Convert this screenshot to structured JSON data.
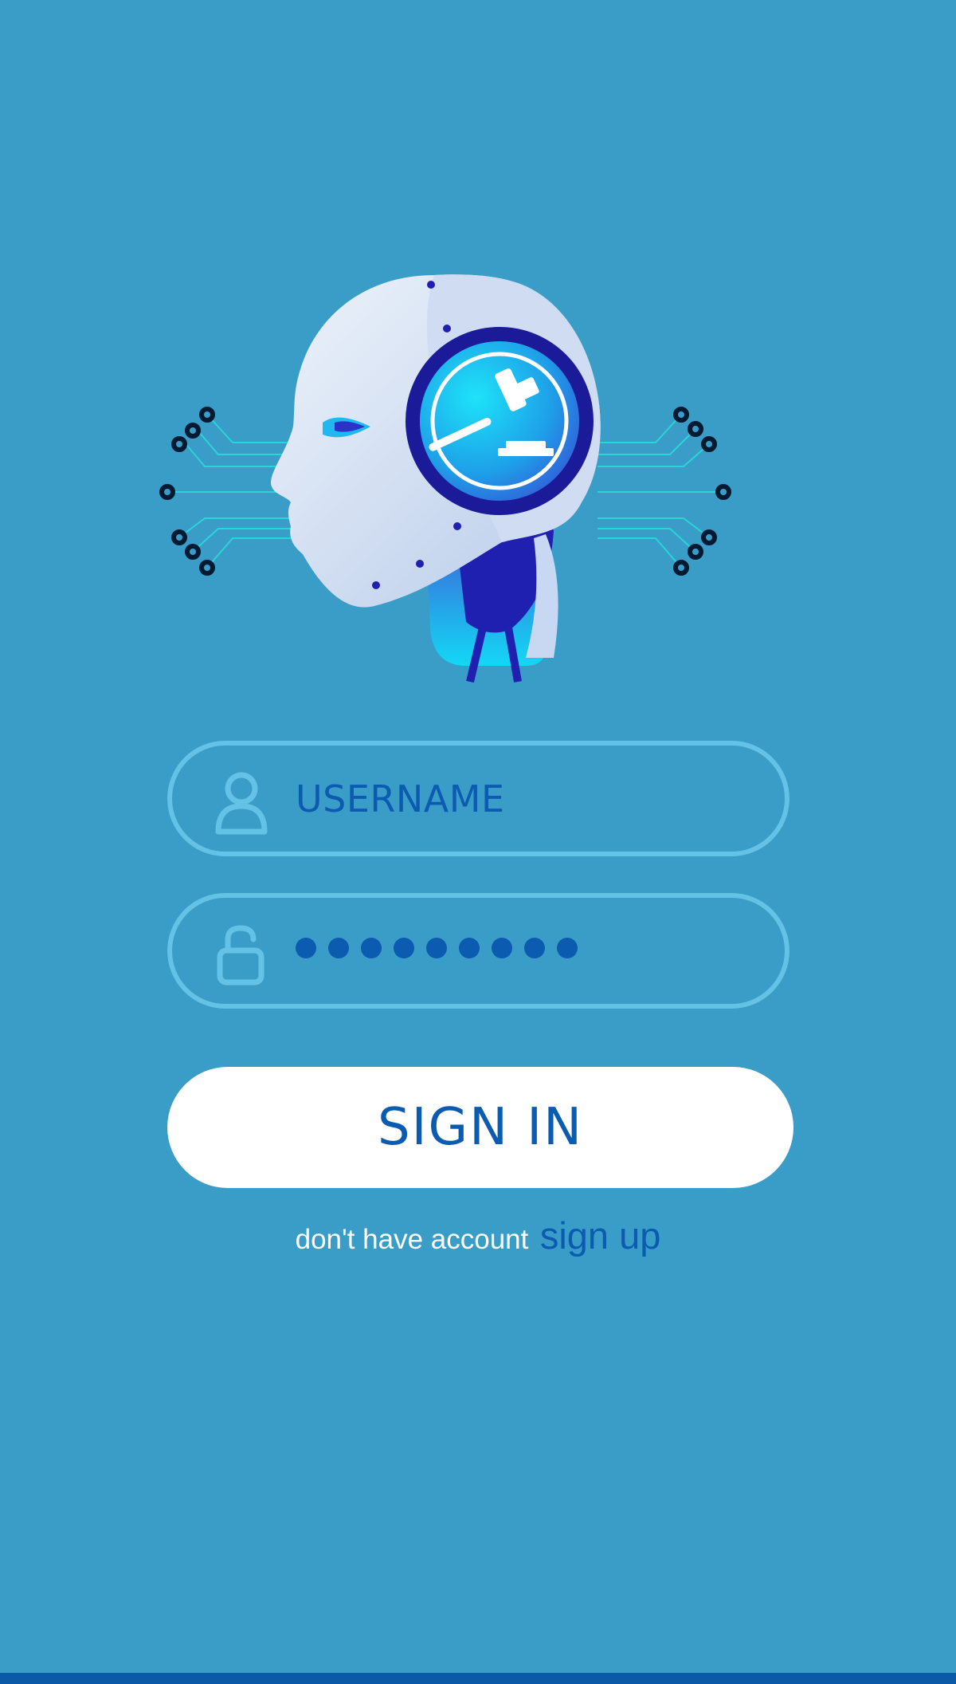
{
  "hero": {
    "icon": "robot-head-with-gavel-icon"
  },
  "form": {
    "username": {
      "placeholder": "USERNAME",
      "value": "",
      "icon": "user-icon"
    },
    "password": {
      "masked_length": 9,
      "icon": "unlock-icon"
    },
    "signin_label": "SIGN IN"
  },
  "signup": {
    "prompt": "don't have account",
    "link_label": "sign up"
  },
  "colors": {
    "background": "#3a9dc7",
    "field_border": "#63c2e6",
    "accent": "#0b5bb0",
    "button_bg": "#ffffff",
    "bottom_bar": "#0a5aa8"
  }
}
